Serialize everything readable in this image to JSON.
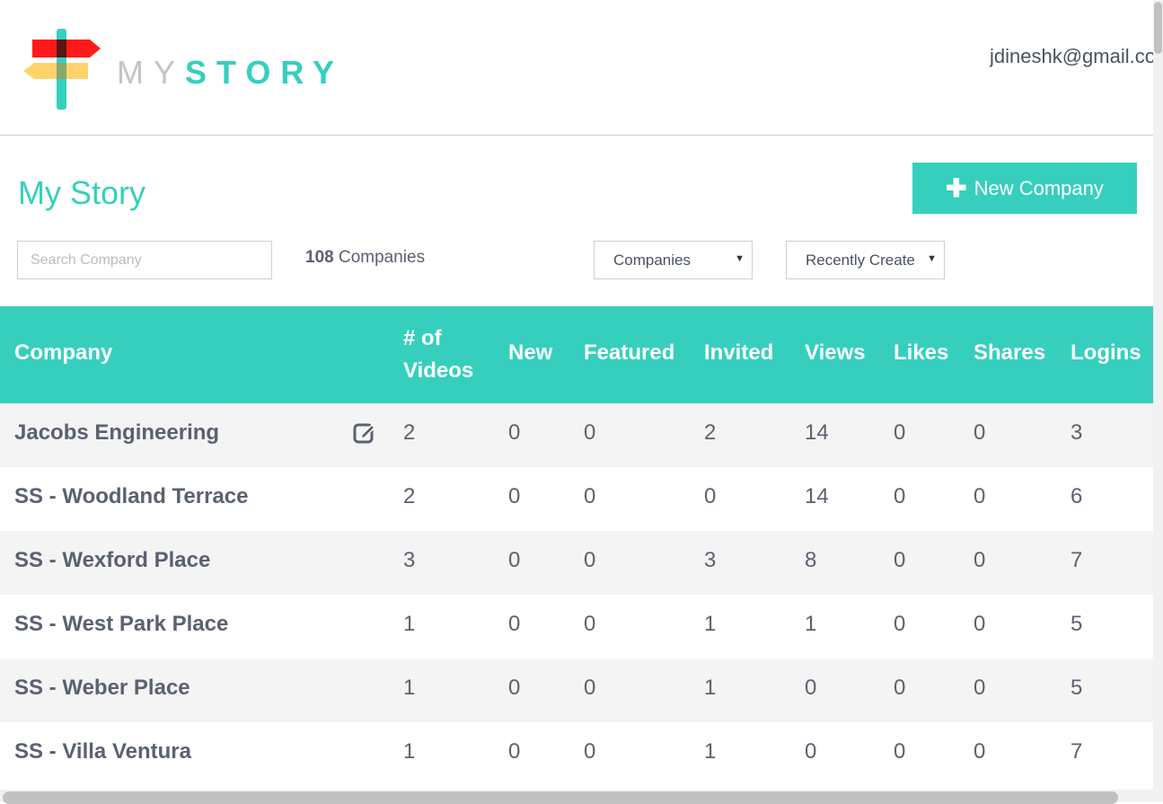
{
  "header": {
    "logo_text_my": "MY",
    "logo_text_story": "STORY",
    "user_email": "jdineshk@gmail.com"
  },
  "page": {
    "title": "My Story",
    "new_company_label": "New Company"
  },
  "toolbar": {
    "search_placeholder": "Search Company",
    "company_count": "108",
    "company_count_label": "Companies",
    "type_filter": "Companies",
    "sort_filter": "Recently Created"
  },
  "table": {
    "columns": [
      "Company",
      "# of Videos",
      "New",
      "Featured",
      "Invited",
      "Views",
      "Likes",
      "Shares",
      "Logins"
    ],
    "columns_split": {
      "videos_line1": "# of",
      "videos_line2": "Videos"
    },
    "rows": [
      {
        "company": "Jacobs Engineering",
        "videos": "2",
        "new": "0",
        "featured": "0",
        "invited": "2",
        "views": "14",
        "likes": "0",
        "shares": "0",
        "logins": "3"
      },
      {
        "company": "SS - Woodland Terrace",
        "videos": "2",
        "new": "0",
        "featured": "0",
        "invited": "0",
        "views": "14",
        "likes": "0",
        "shares": "0",
        "logins": "6"
      },
      {
        "company": "SS - Wexford Place",
        "videos": "3",
        "new": "0",
        "featured": "0",
        "invited": "3",
        "views": "8",
        "likes": "0",
        "shares": "0",
        "logins": "7"
      },
      {
        "company": "SS - West Park Place",
        "videos": "1",
        "new": "0",
        "featured": "0",
        "invited": "1",
        "views": "1",
        "likes": "0",
        "shares": "0",
        "logins": "5"
      },
      {
        "company": "SS - Weber Place",
        "videos": "1",
        "new": "0",
        "featured": "0",
        "invited": "1",
        "views": "0",
        "likes": "0",
        "shares": "0",
        "logins": "5"
      },
      {
        "company": "SS - Villa Ventura",
        "videos": "1",
        "new": "0",
        "featured": "0",
        "invited": "1",
        "views": "0",
        "likes": "0",
        "shares": "0",
        "logins": "7"
      }
    ]
  },
  "colors": {
    "accent": "#36cfbe",
    "text": "#5a6170",
    "row_alt": "#f4f4f4"
  },
  "icons": {
    "logo": "signpost-icon",
    "add": "plus-icon",
    "edit": "edit-icon",
    "dropdown": "caret-down-icon"
  }
}
